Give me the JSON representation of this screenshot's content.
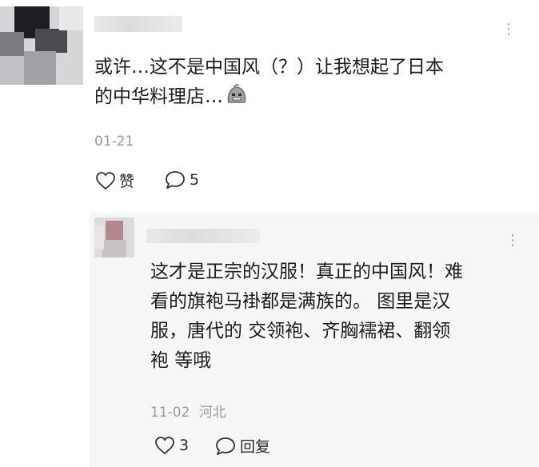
{
  "comment": {
    "text_line1": "或许…这不是中国风（？）让我想起了日本",
    "text_line2": "的中华料理店…",
    "emoji": "grimace-emoji",
    "date": "01-21",
    "like_label": "赞",
    "reply_count": "5",
    "more_label": "⋮"
  },
  "reply": {
    "text_line1": "这才是正宗的汉服！真正的中国风！难",
    "text_line2": "看的旗袍马褂都是满族的。 图里是汉",
    "text_line3": "服，唐代的 交领袍、齐胸襦裙、翻领",
    "text_line4": "袍 等哦",
    "date": "11-02",
    "location": "河北",
    "like_count": "3",
    "reply_label": "回复",
    "more_label": "⋮"
  },
  "colors": {
    "background": "#ffffff",
    "reply_background": "#f6f6f7",
    "meta": "#9b9b9b"
  }
}
